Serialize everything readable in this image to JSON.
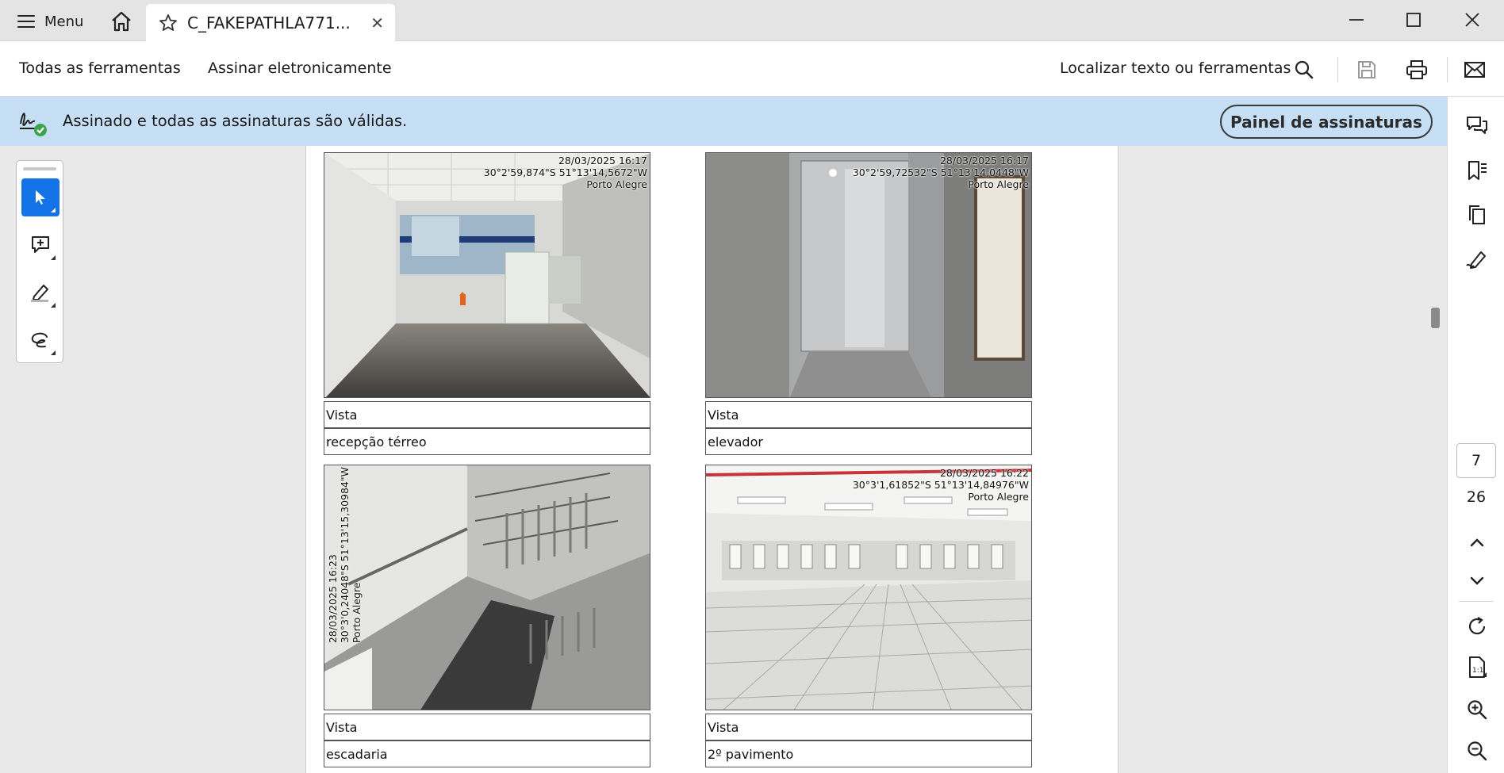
{
  "titlebar": {
    "menu_label": "Menu",
    "tab_title": "C_FAKEPATHLA771...",
    "close_tab_glyph": "✕"
  },
  "toolbar": {
    "all_tools_label": "Todas as ferramentas",
    "esign_label": "Assinar eletronicamente",
    "search_label": "Localizar texto ou ferramentas"
  },
  "signature_bar": {
    "message": "Assinado e todas as assinaturas são válidas.",
    "panel_button": "Painel de assinaturas",
    "accent": "#c6dff5"
  },
  "navigation": {
    "current_page": "7",
    "total_pages": "26"
  },
  "document": {
    "photos": [
      {
        "stamp_lines": [
          "28/03/2025 16:17",
          "30°2'59,874\"S 51°13'14,5672\"W",
          "Porto Alegre"
        ],
        "label": "Vista",
        "caption": "recepção térreo"
      },
      {
        "stamp_lines": [
          "28/03/2025 16:17",
          "30°2'59,72532\"S 51°13'14,0448\"W",
          "Porto Alegre"
        ],
        "label": "Vista",
        "caption": "elevador"
      },
      {
        "stamp_lines": [
          "28/03/2025 16:23",
          "30°3'0,24048\"S 51°13'15,30984\"W",
          "Porto Alegre"
        ],
        "label": "Vista",
        "caption": "escadaria"
      },
      {
        "stamp_lines": [
          "28/03/2025 16:22",
          "30°3'1,61852\"S 51°13'14,84976\"W",
          "Porto Alegre"
        ],
        "label": "Vista",
        "caption": "2º pavimento"
      }
    ]
  },
  "colors": {
    "active_tool": "#1473e6",
    "valid_check": "#3fa34d"
  }
}
